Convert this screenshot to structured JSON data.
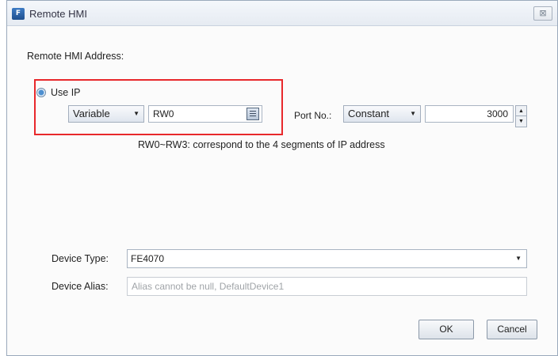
{
  "window": {
    "title": "Remote HMI",
    "icon": "app-icon",
    "close_glyph": "⊠"
  },
  "address_section": {
    "label": "Remote HMI Address:"
  },
  "use_ip": {
    "label": "Use IP",
    "selected": true
  },
  "ip_source": {
    "mode_value": "Variable",
    "address_value": "RW0",
    "hint": "RW0~RW3: correspond to the 4 segments of IP address"
  },
  "port": {
    "label": "Port No.:",
    "mode_value": "Constant",
    "number_value": "3000"
  },
  "device": {
    "type_label": "Device Type:",
    "type_value": "FE4070",
    "alias_label": "Device Alias:",
    "alias_placeholder": "Alias cannot be null, DefaultDevice1"
  },
  "buttons": {
    "ok": "OK",
    "cancel": "Cancel"
  },
  "colors": {
    "highlight": "#e8282b",
    "accent": "#1f4f8e"
  }
}
